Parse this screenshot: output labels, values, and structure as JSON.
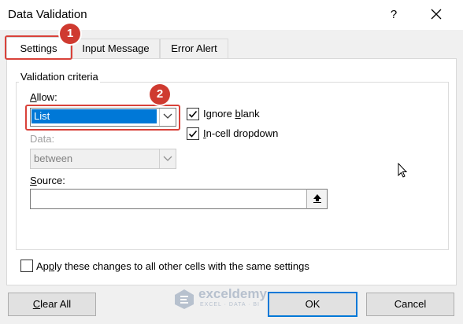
{
  "window": {
    "title": "Data Validation",
    "help_label": "?"
  },
  "tabs": [
    {
      "label": "Settings",
      "active": true
    },
    {
      "label": "Input Message",
      "active": false
    },
    {
      "label": "Error Alert",
      "active": false
    }
  ],
  "validation_criteria": {
    "legend": "Validation criteria",
    "allow_label": "Allow:",
    "allow_value": "List",
    "data_label": "Data:",
    "data_value": "between",
    "source_label": "Source:",
    "source_value": "",
    "ignore_blank": {
      "label": "Ignore blank",
      "checked": true
    },
    "in_cell_dropdown": {
      "label": "In-cell dropdown",
      "checked": true
    }
  },
  "apply_all": {
    "label": "Apply these changes to all other cells with the same settings",
    "checked": false
  },
  "buttons": {
    "clear_all": "Clear All",
    "ok": "OK",
    "cancel": "Cancel"
  },
  "annotations": {
    "badge_1": "1",
    "badge_2": "2",
    "highlight_color": "#d9423a"
  },
  "watermark": {
    "name": "exceldemy",
    "tagline": "EXCEL · DATA · BI"
  },
  "colors": {
    "accent": "#0078d7",
    "dialog_bg": "#f0f0f0",
    "panel_bg": "#ffffff"
  }
}
